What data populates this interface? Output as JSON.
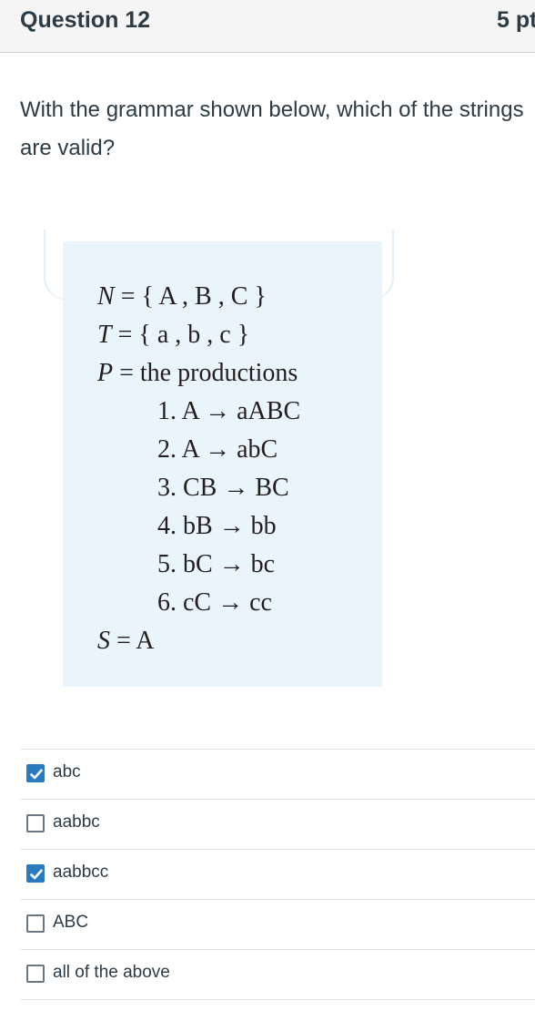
{
  "question": {
    "title": "Question 12",
    "points": "5 pt",
    "prompt": "With the grammar shown below, which of the strings are valid?"
  },
  "grammar": {
    "N": {
      "lhs": "N",
      "eq": "=",
      "rhs": "{ A , B , C }"
    },
    "T": {
      "lhs": "T",
      "eq": "=",
      "rhs": "{ a , b , c }"
    },
    "P": {
      "lhs": "P",
      "eq": "=",
      "rhs": "the productions"
    },
    "productions": [
      "1. A → aABC",
      "2. A → abC",
      "3. CB → BC",
      "4. bB → bb",
      "5. bC → bc",
      "6. cC → cc"
    ],
    "S": {
      "lhs": "S",
      "eq": "=",
      "rhs": "A"
    }
  },
  "options": [
    {
      "label": "abc",
      "checked": true,
      "icon": "checkbox-checked-icon"
    },
    {
      "label": "aabbc",
      "checked": false,
      "icon": "checkbox-icon"
    },
    {
      "label": "aabbcc",
      "checked": true,
      "icon": "checkbox-checked-icon"
    },
    {
      "label": "ABC",
      "checked": false,
      "icon": "checkbox-icon"
    },
    {
      "label": "all of the above",
      "checked": false,
      "icon": "checkbox-icon"
    }
  ],
  "colors": {
    "header_bg": "#f5f5f5",
    "figure_bg": "#e9f4fb",
    "checkbox_checked": "#2a7abf",
    "text": "#2d3b45"
  }
}
